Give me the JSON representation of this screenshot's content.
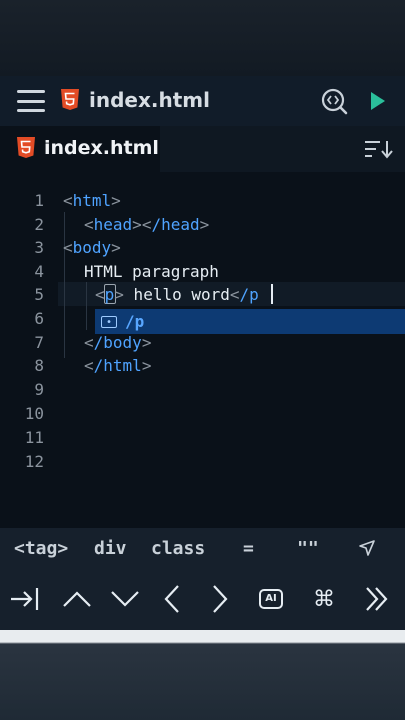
{
  "app_bar": {
    "title": "index.html",
    "menu_icon": "hamburger-menu-icon",
    "file_icon": "html5-icon",
    "search_icon": "search-code-icon",
    "run_icon": "play-icon"
  },
  "tab": {
    "title": "index.html",
    "file_icon": "html5-icon",
    "sort_icon": "sort-lines-icon"
  },
  "editor": {
    "line_numbers": [
      "1",
      "2",
      "3",
      "4",
      "5",
      "6",
      "7",
      "8",
      "9",
      "10",
      "11",
      "12"
    ],
    "lines": {
      "l1_tag": "html",
      "l2_tag_open": "head",
      "l2_tag_close": "/head",
      "l3_tag": "body",
      "l4_text": "HTML paragraph",
      "l5_tag_open": "p",
      "l5_text": " hello word",
      "l5_tag_close_partial": "/p",
      "l7_tag": "/body",
      "l8_tag": "/html"
    },
    "brackets": {
      "open": "<",
      "close": ">"
    },
    "suggestion": {
      "icon": "snippet-icon",
      "label": "/p"
    }
  },
  "symbols": [
    "<tag>",
    "div",
    "class",
    "=",
    "\"\""
  ],
  "symbol_send_icon": "send-arrow-icon",
  "keys": [
    {
      "name": "tab-key",
      "icon": "tab-arrow-icon"
    },
    {
      "name": "up-key",
      "icon": "chevron-up-icon"
    },
    {
      "name": "down-key",
      "icon": "chevron-down-icon"
    },
    {
      "name": "left-key",
      "icon": "chevron-left-icon"
    },
    {
      "name": "right-key",
      "icon": "chevron-right-icon"
    },
    {
      "name": "ai-key",
      "icon": "ai-icon",
      "label": "AI"
    },
    {
      "name": "command-key",
      "icon": "command-icon",
      "label": "⌘"
    },
    {
      "name": "more-key",
      "icon": "double-chevron-right-icon"
    }
  ],
  "colors": {
    "accent_blue": "#4fa3ff",
    "html5_orange": "#e34c26",
    "run_green": "#2bbf9b",
    "suggest_bg": "#0d3a73"
  }
}
